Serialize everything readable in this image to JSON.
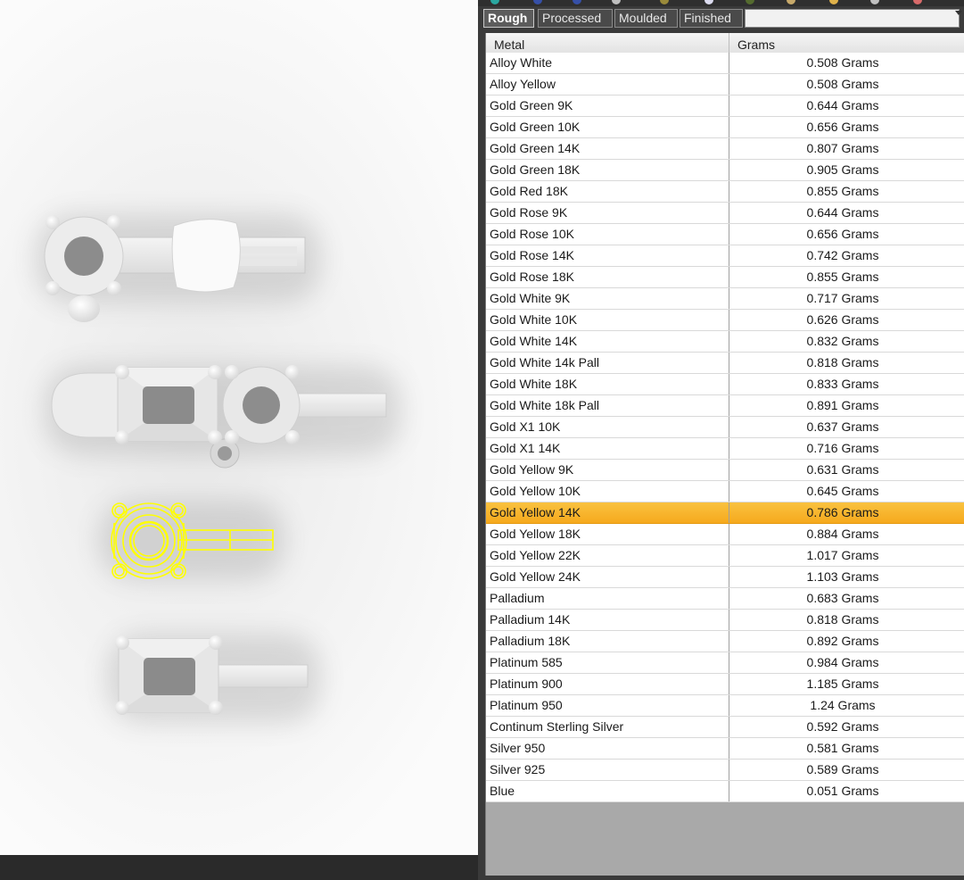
{
  "tabs": [
    {
      "label": "Rough",
      "active": true
    },
    {
      "label": "Processed",
      "active": false
    },
    {
      "label": "Moulded",
      "active": false
    },
    {
      "label": "Finished",
      "active": false
    }
  ],
  "table": {
    "columns": {
      "metal": "Metal",
      "grams": "Grams"
    },
    "selected_index": 21,
    "rows": [
      {
        "metal": "Alloy White",
        "grams": "0.508 Grams"
      },
      {
        "metal": "Alloy Yellow",
        "grams": "0.508 Grams"
      },
      {
        "metal": "Gold Green 9K",
        "grams": "0.644 Grams"
      },
      {
        "metal": "Gold Green 10K",
        "grams": "0.656 Grams"
      },
      {
        "metal": "Gold Green 14K",
        "grams": "0.807 Grams"
      },
      {
        "metal": "Gold Green 18K",
        "grams": "0.905 Grams"
      },
      {
        "metal": "Gold Red 18K",
        "grams": "0.855 Grams"
      },
      {
        "metal": "Gold Rose 9K",
        "grams": "0.644 Grams"
      },
      {
        "metal": "Gold Rose 10K",
        "grams": "0.656 Grams"
      },
      {
        "metal": "Gold Rose 14K",
        "grams": "0.742 Grams"
      },
      {
        "metal": "Gold Rose 18K",
        "grams": "0.855 Grams"
      },
      {
        "metal": "Gold White 9K",
        "grams": "0.717 Grams"
      },
      {
        "metal": "Gold White 10K",
        "grams": "0.626 Grams"
      },
      {
        "metal": "Gold White 14K",
        "grams": "0.832 Grams"
      },
      {
        "metal": "Gold White 14k Pall",
        "grams": "0.818 Grams"
      },
      {
        "metal": "Gold White 18K",
        "grams": "0.833 Grams"
      },
      {
        "metal": "Gold White 18k Pall",
        "grams": "0.891 Grams"
      },
      {
        "metal": "Gold X1 10K",
        "grams": "0.637 Grams"
      },
      {
        "metal": "Gold X1 14K",
        "grams": "0.716 Grams"
      },
      {
        "metal": "Gold Yellow 9K",
        "grams": "0.631 Grams"
      },
      {
        "metal": "Gold Yellow 10K",
        "grams": "0.645 Grams"
      },
      {
        "metal": "Gold Yellow 14K",
        "grams": "0.786 Grams"
      },
      {
        "metal": "Gold Yellow 18K",
        "grams": "0.884 Grams"
      },
      {
        "metal": "Gold Yellow 22K",
        "grams": "1.017 Grams"
      },
      {
        "metal": "Gold Yellow 24K",
        "grams": "1.103 Grams"
      },
      {
        "metal": "Palladium",
        "grams": "0.683 Grams"
      },
      {
        "metal": "Palladium 14K",
        "grams": "0.818 Grams"
      },
      {
        "metal": "Palladium 18K",
        "grams": "0.892 Grams"
      },
      {
        "metal": "Platinum 585",
        "grams": "0.984 Grams"
      },
      {
        "metal": "Platinum 900",
        "grams": "1.185 Grams"
      },
      {
        "metal": "Platinum 950",
        "grams": "1.24 Grams"
      },
      {
        "metal": "Continum Sterling Silver",
        "grams": "0.592 Grams"
      },
      {
        "metal": "Silver 950",
        "grams": "0.581 Grams"
      },
      {
        "metal": "Silver 925",
        "grams": "0.589 Grams"
      },
      {
        "metal": "Blue",
        "grams": "0.051 Grams"
      }
    ]
  },
  "colors": {
    "selection": "#f6a91d",
    "wireframe": "#ffff00",
    "panel_bg": "#3a3a3a"
  }
}
